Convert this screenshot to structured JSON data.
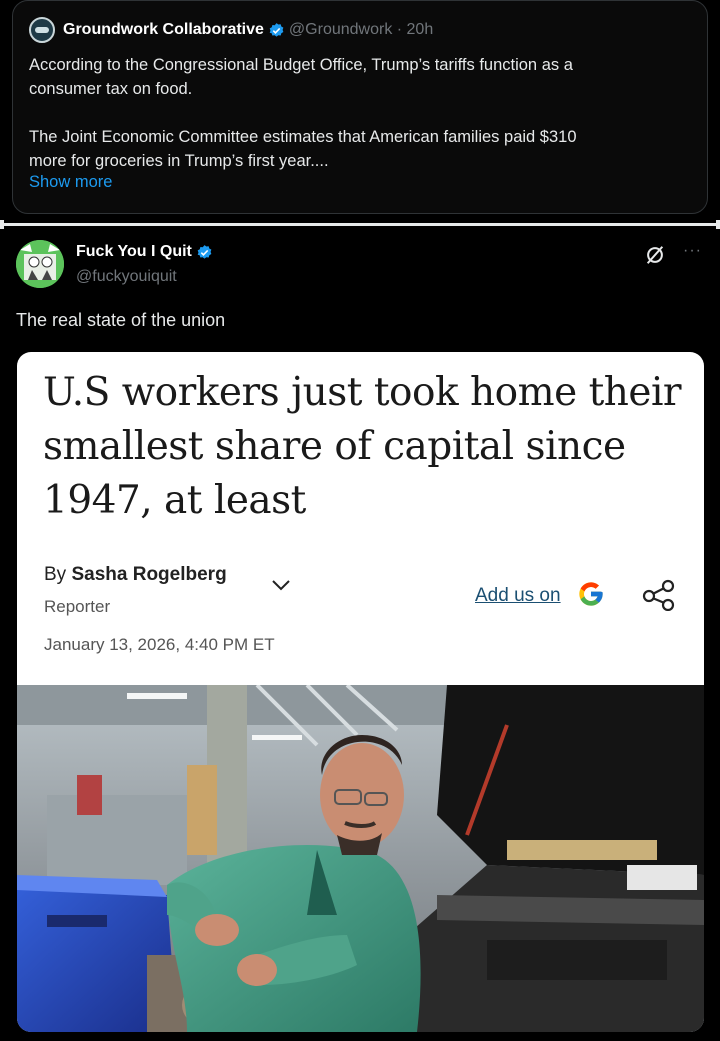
{
  "quoted_tweet": {
    "author_name": "Groundwork Collaborative",
    "handle_time": "@Groundwork · 20h",
    "text": "According to the Congressional Budget Office, Trump’s tariffs function as a\nconsumer tax on food.\n\nThe Joint Economic Committee estimates that American families paid $310\nmore for groceries in Trump’s first year....",
    "show_more_label": "Show more"
  },
  "tweet": {
    "author_name": "Fuck You I Quit",
    "handle": "@fuckyouiquit",
    "text": "The real state of the union",
    "more_label": "···"
  },
  "article": {
    "headline": "U.S workers just took home their smallest share of capital since 1947, at least",
    "byline_prefix": "By",
    "author": "Sasha Rogelberg",
    "role": "Reporter",
    "date": "January 13, 2026, 4:40 PM ET",
    "add_us_label": "Add us on"
  },
  "colors": {
    "background": "#000000",
    "link_blue": "#1d9bf0",
    "verified_blue": "#1d9bf0"
  }
}
